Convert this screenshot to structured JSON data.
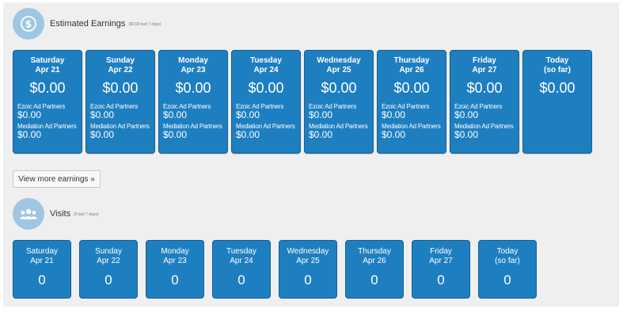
{
  "earnings": {
    "title": "Estimated Earnings",
    "subtitle": "($0.00 last 7 days)",
    "icon": "dollar-coin-icon",
    "days": [
      {
        "day": "Saturday",
        "date": "Apr 21",
        "total": "$0.00",
        "p1_label": "Ezoic Ad Partners",
        "p1_value": "$0.00",
        "p2_label": "Mediation Ad Partners",
        "p2_value": "$0.00"
      },
      {
        "day": "Sunday",
        "date": "Apr 22",
        "total": "$0.00",
        "p1_label": "Ezoic Ad Partners",
        "p1_value": "$0.00",
        "p2_label": "Mediation Ad Partners",
        "p2_value": "$0.00"
      },
      {
        "day": "Monday",
        "date": "Apr 23",
        "total": "$0.00",
        "p1_label": "Ezoic Ad Partners",
        "p1_value": "$0.00",
        "p2_label": "Mediation Ad Partners",
        "p2_value": "$0.00"
      },
      {
        "day": "Tuesday",
        "date": "Apr 24",
        "total": "$0.00",
        "p1_label": "Ezoic Ad Partners",
        "p1_value": "$0.00",
        "p2_label": "Mediation Ad Partners",
        "p2_value": "$0.00"
      },
      {
        "day": "Wednesday",
        "date": "Apr 25",
        "total": "$0.00",
        "p1_label": "Ezoic Ad Partners",
        "p1_value": "$0.00",
        "p2_label": "Mediation Ad Partners",
        "p2_value": "$0.00"
      },
      {
        "day": "Thursday",
        "date": "Apr 26",
        "total": "$0.00",
        "p1_label": "Ezoic Ad Partners",
        "p1_value": "$0.00",
        "p2_label": "Mediation Ad Partners",
        "p2_value": "$0.00"
      },
      {
        "day": "Friday",
        "date": "Apr 27",
        "total": "$0.00",
        "p1_label": "Ezoic Ad Partners",
        "p1_value": "$0.00",
        "p2_label": "Mediation Ad Partners",
        "p2_value": "$0.00"
      },
      {
        "day": "Today",
        "date": "(so far)",
        "total": "$0.00"
      }
    ]
  },
  "view_more": {
    "label": "View more earnings »"
  },
  "visits": {
    "title": "Visits",
    "subtitle": "(0 last 7 days)",
    "icon": "users-icon",
    "days": [
      {
        "day": "Saturday",
        "date": "Apr 21",
        "count": "0"
      },
      {
        "day": "Sunday",
        "date": "Apr 22",
        "count": "0"
      },
      {
        "day": "Monday",
        "date": "Apr 23",
        "count": "0"
      },
      {
        "day": "Tuesday",
        "date": "Apr 24",
        "count": "0"
      },
      {
        "day": "Wednesday",
        "date": "Apr 25",
        "count": "0"
      },
      {
        "day": "Thursday",
        "date": "Apr 26",
        "count": "0"
      },
      {
        "day": "Friday",
        "date": "Apr 27",
        "count": "0"
      },
      {
        "day": "Today",
        "date": "(so far)",
        "count": "0"
      }
    ]
  },
  "colors": {
    "card": "#1e7fc0",
    "icon_circle": "#9fc6e2",
    "panel": "#efefef"
  }
}
